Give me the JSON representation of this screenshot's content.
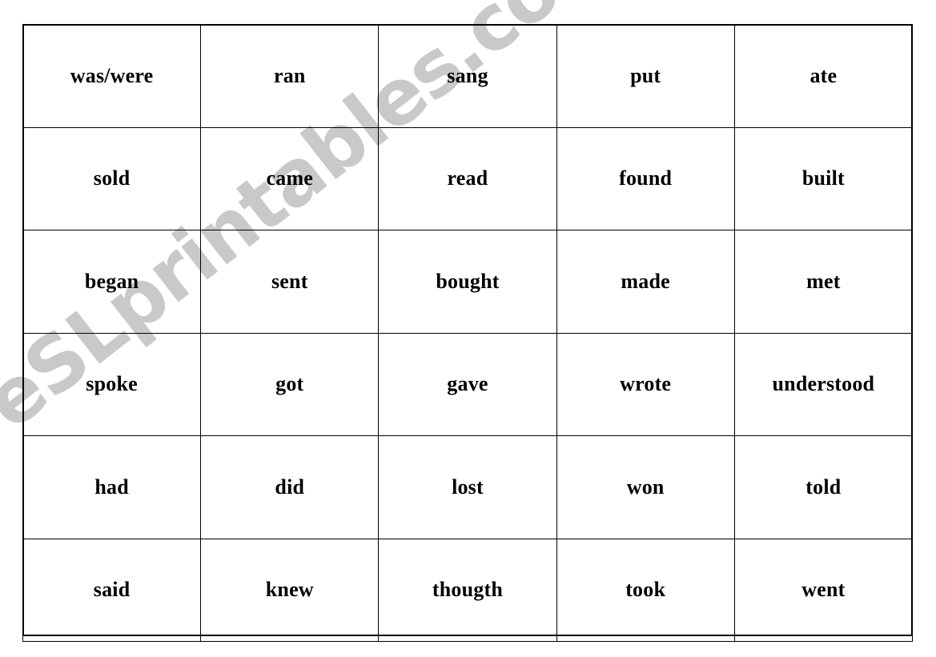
{
  "document": {
    "title": "Irregular Verbs - Past Simple Word Cards",
    "background_color": "#ffffff",
    "text_color": "#000000",
    "border_color": "#000000"
  },
  "watermark": {
    "text": "eSLprintables.com",
    "color": "#c9c9c9",
    "rotation_degrees": -38
  },
  "table": {
    "columns": 5,
    "rows": 6,
    "rows_data": [
      [
        "was/were",
        "ran",
        "sang",
        "put",
        "ate"
      ],
      [
        "sold",
        "came",
        "read",
        "found",
        "built"
      ],
      [
        "began",
        "sent",
        "bought",
        "made",
        "met"
      ],
      [
        "spoke",
        "got",
        "gave",
        "wrote",
        "understood"
      ],
      [
        "had",
        "did",
        "lost",
        "won",
        "told"
      ],
      [
        "said",
        "knew",
        "thougth",
        "took",
        "went"
      ]
    ]
  }
}
